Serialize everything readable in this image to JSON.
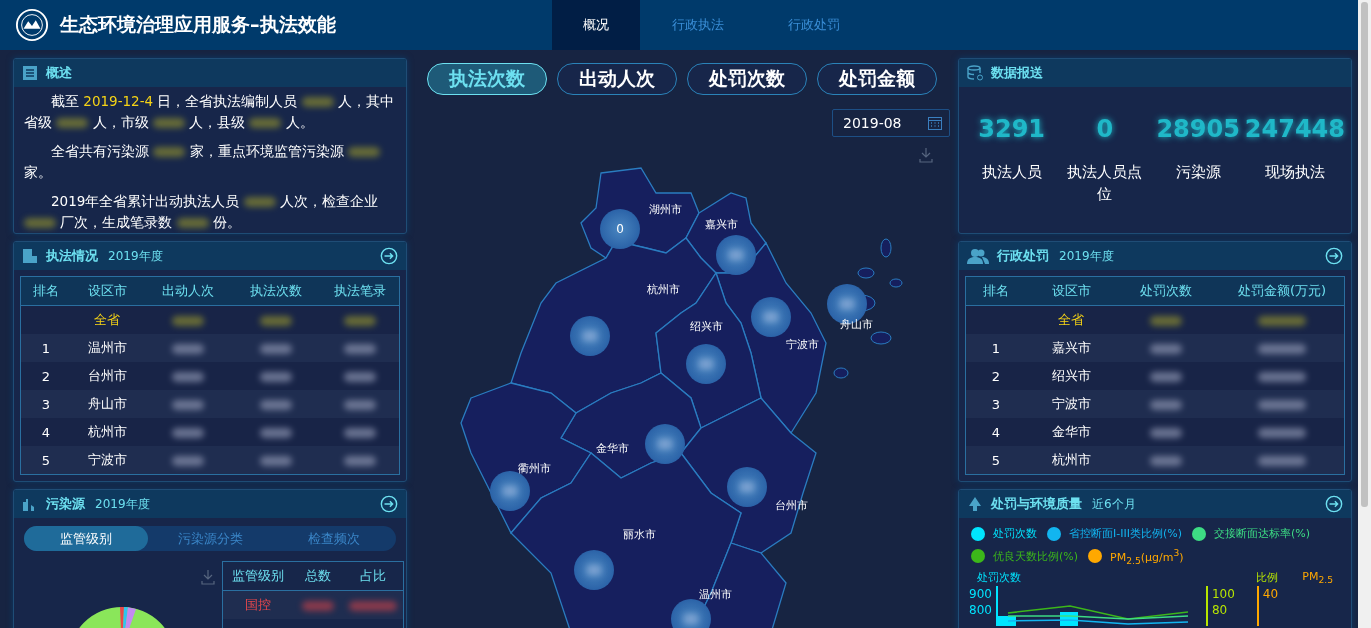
{
  "header": {
    "title": "生态环境治理应用服务–执法效能",
    "tabs": [
      {
        "label": "概况",
        "selected": true
      },
      {
        "label": "行政执法",
        "selected": false
      },
      {
        "label": "行政处罚",
        "selected": false
      }
    ]
  },
  "overview": {
    "title": "概述",
    "paragraphs": [
      [
        {
          "text": "截至 "
        },
        {
          "text": "2019-12-4",
          "kind": "highlight"
        },
        {
          "text": " 日，全省执法编制人员 "
        },
        {
          "kind": "redacted"
        },
        {
          "text": " 人，其中省级 "
        },
        {
          "kind": "redacted"
        },
        {
          "text": " 人，市级 "
        },
        {
          "kind": "redacted"
        },
        {
          "text": " 人，县级 "
        },
        {
          "kind": "redacted"
        },
        {
          "text": " 人。"
        }
      ],
      [
        {
          "text": "全省共有污染源 "
        },
        {
          "kind": "redacted"
        },
        {
          "text": " 家，重点环境监管污染源 "
        },
        {
          "kind": "redacted"
        },
        {
          "text": " 家。"
        }
      ],
      [
        {
          "text": "2019年全省累计出动执法人员 "
        },
        {
          "kind": "redacted"
        },
        {
          "text": " 人次，检查企业 "
        },
        {
          "kind": "redacted"
        },
        {
          "text": " 厂次，生成笔录数 "
        },
        {
          "kind": "redacted"
        },
        {
          "text": " 份。"
        }
      ]
    ]
  },
  "enforcement": {
    "title": "执法情况",
    "subtitle": "2019年度",
    "columns": [
      "排名",
      "设区市",
      "出动人次",
      "执法次数",
      "执法笔录"
    ],
    "rows": [
      {
        "kind": "total",
        "city": "全省"
      },
      {
        "kind": "rank",
        "rank": "1",
        "city": "温州市"
      },
      {
        "kind": "rank",
        "rank": "2",
        "city": "台州市"
      },
      {
        "kind": "rank",
        "rank": "3",
        "city": "舟山市"
      },
      {
        "kind": "rank",
        "rank": "4",
        "city": "杭州市"
      },
      {
        "kind": "rank",
        "rank": "5",
        "city": "宁波市"
      }
    ]
  },
  "pollution": {
    "title": "污染源",
    "subtitle": "2019年度",
    "tabs": [
      {
        "label": "监管级别",
        "selected": true
      },
      {
        "label": "污染源分类",
        "selected": false
      },
      {
        "label": "检查频次",
        "selected": false
      }
    ],
    "columns": [
      "监管级别",
      "总数",
      "占比"
    ],
    "rows": [
      {
        "label": "国控"
      }
    ]
  },
  "metric_buttons": [
    {
      "label": "执法次数",
      "selected": true
    },
    {
      "label": "出动人次",
      "selected": false
    },
    {
      "label": "处罚次数",
      "selected": false
    },
    {
      "label": "处罚金额",
      "selected": false
    }
  ],
  "date_field": {
    "value": "2019-08"
  },
  "map": {
    "cities": [
      {
        "name": "湖州市",
        "value": "0"
      },
      {
        "name": "嘉兴市"
      },
      {
        "name": "杭州市"
      },
      {
        "name": "绍兴市"
      },
      {
        "name": "宁波市"
      },
      {
        "name": "舟山市"
      },
      {
        "name": "金华市"
      },
      {
        "name": "衢州市"
      },
      {
        "name": "台州市"
      },
      {
        "name": "丽水市"
      },
      {
        "name": "温州市"
      }
    ]
  },
  "reporting": {
    "title": "数据报送",
    "stats": [
      {
        "value": "3291",
        "label": "执法人员"
      },
      {
        "value": "0",
        "label": "执法人员点位"
      },
      {
        "value": "28905",
        "label": "污染源"
      },
      {
        "value": "247448",
        "label": "现场执法"
      }
    ]
  },
  "penalty": {
    "title": "行政处罚",
    "subtitle": "2019年度",
    "columns": [
      "排名",
      "设区市",
      "处罚次数",
      "处罚金额(万元)"
    ],
    "rows": [
      {
        "kind": "total",
        "city": "全省"
      },
      {
        "kind": "rank",
        "rank": "1",
        "city": "嘉兴市"
      },
      {
        "kind": "rank",
        "rank": "2",
        "city": "绍兴市"
      },
      {
        "kind": "rank",
        "rank": "3",
        "city": "宁波市"
      },
      {
        "kind": "rank",
        "rank": "4",
        "city": "金华市"
      },
      {
        "kind": "rank",
        "rank": "5",
        "city": "杭州市"
      }
    ]
  },
  "quality": {
    "title": "处罚与环境质量",
    "subtitle": "近6个月",
    "legend": [
      {
        "label": "处罚次数",
        "color": "#00e5ff"
      },
      {
        "label": "省控断面I-III类比例(%)",
        "color": "#12b5f0"
      },
      {
        "label": "交接断面达标率(%)",
        "color": "#3ddc84"
      },
      {
        "label": "优良天数比例(%)",
        "color": "#3cb71a"
      },
      {
        "label": "PM$_{2.5}$(μg/m$^{3}$)",
        "color": "#ffa800"
      }
    ],
    "axes": [
      {
        "title": "处罚次数",
        "ticks": [
          "900",
          "800"
        ],
        "color": "#00e5ff"
      },
      {
        "title": "比例",
        "ticks": [
          "100",
          "80"
        ],
        "color": "#b8e600"
      },
      {
        "title": "PM$_{2.5}$",
        "ticks": [
          "40"
        ],
        "color": "#ffa800"
      }
    ]
  }
}
